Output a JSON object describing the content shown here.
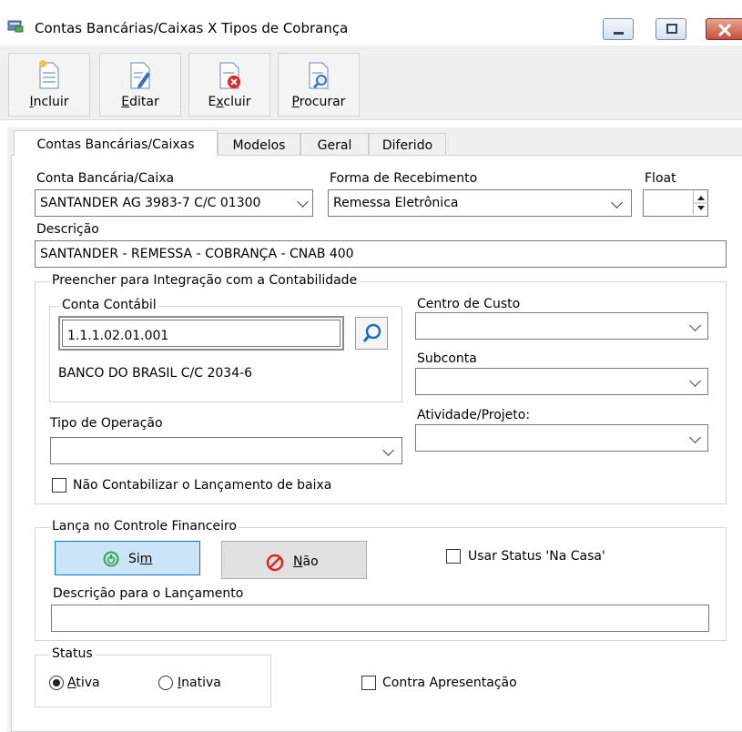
{
  "window": {
    "title": "Contas Bancárias/Caixas X Tipos de Cobrança"
  },
  "toolbar": {
    "incluir": {
      "pre": "",
      "key": "I",
      "post": "ncluir"
    },
    "editar": {
      "pre": "",
      "key": "E",
      "post": "ditar"
    },
    "excluir": {
      "pre": "E",
      "key": "x",
      "post": "cluir"
    },
    "procurar": {
      "pre": "",
      "key": "P",
      "post": "rocurar"
    }
  },
  "tabs": [
    "Contas Bancárias/Caixas",
    "Modelos",
    "Geral",
    "Diferido"
  ],
  "form": {
    "conta_label": "Conta Bancária/Caixa",
    "conta_value": "SANTANDER AG 3983-7 C/C 01300",
    "forma_label": "Forma de Recebimento",
    "forma_value": "Remessa Eletrônica",
    "float_label": "Float",
    "descricao_label": "Descrição",
    "descricao_value": "SANTANDER - REMESSA - COBRANÇA - CNAB 400"
  },
  "integracao": {
    "legend": "Preencher para Integração com a Contabilidade",
    "conta_contabil_legend": "Conta Contábil",
    "conta_contabil_value": "1.1.1.02.01.001",
    "conta_contabil_desc": "BANCO DO BRASIL C/C 2034-6",
    "centro_custo_label": "Centro de Custo",
    "subconta_label": "Subconta",
    "atividade_label": "Atividade/Projeto:",
    "tipo_operacao_label": "Tipo de Operação",
    "nao_contabilizar_label": "Não Contabilizar o Lançamento de baixa"
  },
  "financeiro": {
    "legend": "Lança no Controle Financeiro",
    "sim": {
      "pre": "Si",
      "key": "m",
      "post": ""
    },
    "nao": {
      "pre": "",
      "key": "N",
      "post": "ão"
    },
    "usar_status_label": "Usar Status 'Na Casa'",
    "descricao_lanc_label": "Descrição para o Lançamento"
  },
  "status": {
    "legend": "Status",
    "ativa_pre": "",
    "ativa_key": "A",
    "ativa_post": "tiva",
    "inativa_pre": "",
    "inativa_key": "I",
    "inativa_post": "nativa",
    "contra_label": "Contra Apresentação"
  },
  "colors": {
    "accent": "#cce4f7",
    "sim_icon": "#2ea84a",
    "nao_icon": "#d9281e",
    "search_icon": "#1a6fb5"
  }
}
